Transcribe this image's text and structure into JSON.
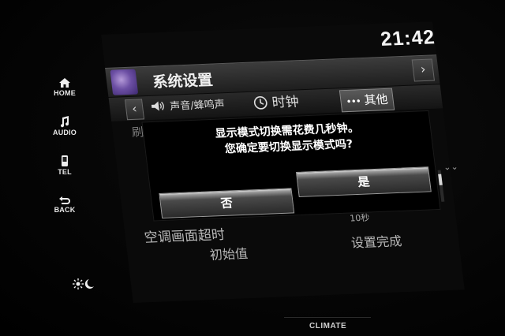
{
  "side_buttons": [
    {
      "id": "home",
      "label": "HOME",
      "icon": "home-icon"
    },
    {
      "id": "audio",
      "label": "AUDIO",
      "icon": "music-note-icon"
    },
    {
      "id": "tel",
      "label": "TEL",
      "icon": "phone-icon"
    },
    {
      "id": "back",
      "label": "BACK",
      "icon": "back-arrow-icon"
    }
  ],
  "daynight_icon": "sun-moon-icon",
  "clock": "21:42",
  "header": {
    "title": "系统设置",
    "app_icon": "settings-app-icon",
    "next_arrow": "›"
  },
  "tabs": {
    "prev_arrow": "‹",
    "items": [
      {
        "label": "声音/蜂鸣声",
        "icon": "speaker-icon"
      },
      {
        "label": "时钟",
        "icon": "clock-icon"
      },
      {
        "label": "其他",
        "icon": "ellipsis-icon",
        "prefix": "•••",
        "active": true
      }
    ]
  },
  "background_list": {
    "row1_partial": "刷新中在",
    "row2_label": "空调画面超时",
    "row2_value": "10秒",
    "row3_label": "初始值",
    "row3_value": "设置完成"
  },
  "dialog": {
    "line1": "显示模式切换需花费几秒钟。",
    "line2": "您确定要切换显示模式吗?",
    "no_label": "否",
    "yes_label": "是"
  },
  "scroll": {
    "position": 0.2
  },
  "bezel_label": "CLIMATE",
  "colors": {
    "text": "#ffffff",
    "background": "#000000",
    "button_highlight": "#dcdcdc"
  }
}
